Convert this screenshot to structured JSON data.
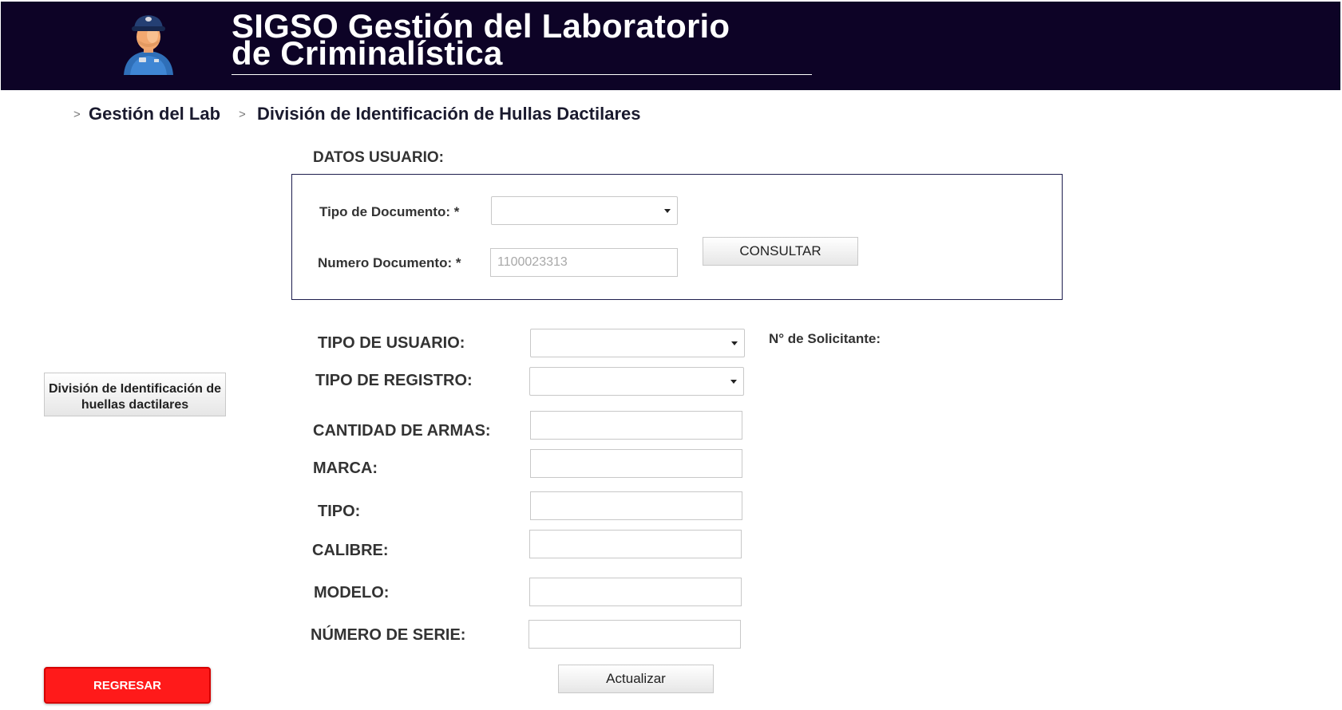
{
  "header": {
    "title_line1": "SIGSO  Gestión del Laboratorio",
    "title_line2": "de Criminalística"
  },
  "breadcrumb": {
    "separator": ">",
    "items": [
      "Gestión del Lab",
      "División de Identificación de Hullas Dactilares"
    ]
  },
  "user_section": {
    "title": "DATOS USUARIO:",
    "doc_type_label": "Tipo de Documento: *",
    "doc_type_value": "",
    "doc_number_label": "Numero Documento: *",
    "doc_number_placeholder": "1100023313",
    "consult_button": "CONSULTAR"
  },
  "form": {
    "user_type_label": "TIPO DE  USUARIO:",
    "user_type_value": "",
    "requester_label": "N° de Solicitante:",
    "registry_type_label": "TIPO DE REGISTRO:",
    "registry_type_value": "",
    "weapons_qty_label": "CANTIDAD DE ARMAS:",
    "brand_label": "MARCA:",
    "type_label": "TIPO:",
    "caliber_label": "CALIBRE:",
    "model_label": "MODELO:",
    "serial_label": "NÚMERO DE SERIE:",
    "update_button": "Actualizar"
  },
  "sidebar": {
    "division_button": "División de Identificación de huellas dactilares",
    "back_button": "REGRESAR"
  },
  "colors": {
    "header_bg": "#0d0326",
    "box_border": "#1d1d4d",
    "back_button": "#ff1a1a"
  }
}
